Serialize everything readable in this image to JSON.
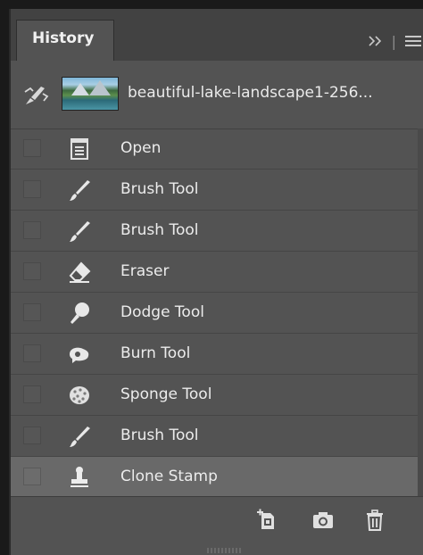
{
  "panel": {
    "tab_label": "History",
    "controls": {
      "collapse_icon": "double-chevron-right-icon",
      "separator": "|",
      "menu_icon": "hamburger-menu-icon"
    }
  },
  "snapshot": {
    "source_icon": "history-brush-source-icon",
    "label": "beautiful-lake-landscape1-256..."
  },
  "history_items": [
    {
      "label": "Open",
      "icon": "document-icon",
      "selected": false
    },
    {
      "label": "Brush Tool",
      "icon": "brush-icon",
      "selected": false
    },
    {
      "label": "Brush Tool",
      "icon": "brush-icon",
      "selected": false
    },
    {
      "label": "Eraser",
      "icon": "eraser-icon",
      "selected": false
    },
    {
      "label": "Dodge Tool",
      "icon": "dodge-icon",
      "selected": false
    },
    {
      "label": "Burn Tool",
      "icon": "burn-icon",
      "selected": false
    },
    {
      "label": "Sponge Tool",
      "icon": "sponge-icon",
      "selected": false
    },
    {
      "label": "Brush Tool",
      "icon": "brush-icon",
      "selected": false
    },
    {
      "label": "Clone Stamp",
      "icon": "clone-stamp-icon",
      "selected": true
    }
  ],
  "footer": {
    "buttons": [
      "new-document-from-state-icon",
      "camera-snapshot-icon",
      "trash-icon"
    ]
  },
  "colors": {
    "panel_bg": "#535353",
    "selected_row": "#696969",
    "text": "#ececec"
  }
}
